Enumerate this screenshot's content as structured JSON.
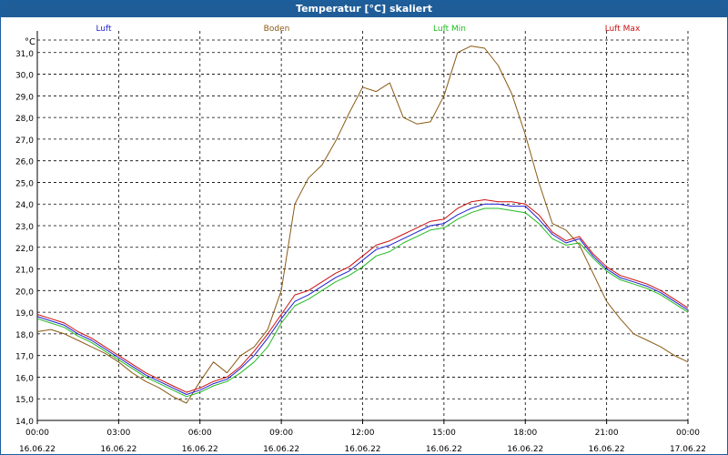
{
  "window": {
    "title": "Temperatur [°C] skaliert"
  },
  "chart_data": {
    "type": "line",
    "title": "Temperatur [°C] skaliert",
    "ylabel": "°C",
    "xlabel": "",
    "ylim": [
      14.0,
      32.0
    ],
    "y_ticks": [
      "14,0",
      "15,0",
      "16,0",
      "17,0",
      "18,0",
      "19,0",
      "20,0",
      "21,0",
      "22,0",
      "23,0",
      "24,0",
      "25,0",
      "26,0",
      "27,0",
      "28,0",
      "29,0",
      "30,0",
      "31,0"
    ],
    "x_ticks": [
      {
        "time": "00:00",
        "date": "16.06.22"
      },
      {
        "time": "03:00",
        "date": "16.06.22"
      },
      {
        "time": "06:00",
        "date": "16.06.22"
      },
      {
        "time": "09:00",
        "date": "16.06.22"
      },
      {
        "time": "12:00",
        "date": "16.06.22"
      },
      {
        "time": "15:00",
        "date": "16.06.22"
      },
      {
        "time": "18:00",
        "date": "16.06.22"
      },
      {
        "time": "21:00",
        "date": "16.06.22"
      },
      {
        "time": "00:00",
        "date": "17.06.22"
      }
    ],
    "x_range_hours": [
      0,
      24
    ],
    "grid": true,
    "legend_position": "top",
    "series": [
      {
        "name": "Luft",
        "color": "#1f1fd0",
        "x": [
          0,
          0.5,
          1,
          1.5,
          2,
          2.5,
          3,
          3.5,
          4,
          4.5,
          5,
          5.5,
          6,
          6.5,
          7,
          7.5,
          8,
          8.5,
          9,
          9.5,
          10,
          10.5,
          11,
          11.5,
          12,
          12.5,
          13,
          13.5,
          14,
          14.5,
          15,
          15.5,
          16,
          16.5,
          17,
          17.5,
          18,
          18.5,
          19,
          19.5,
          20,
          20.5,
          21,
          21.5,
          22,
          22.5,
          23,
          23.5,
          24
        ],
        "y": [
          18.8,
          18.6,
          18.4,
          18.0,
          17.7,
          17.3,
          16.9,
          16.5,
          16.1,
          15.8,
          15.5,
          15.2,
          15.4,
          15.7,
          15.9,
          16.4,
          17.0,
          17.8,
          18.7,
          19.5,
          19.8,
          20.2,
          20.6,
          20.9,
          21.4,
          21.9,
          22.1,
          22.4,
          22.7,
          23.0,
          23.1,
          23.5,
          23.8,
          24.0,
          24.0,
          23.9,
          23.9,
          23.3,
          22.6,
          22.2,
          22.4,
          21.6,
          21.0,
          20.6,
          20.4,
          20.2,
          19.9,
          19.5,
          19.1
        ]
      },
      {
        "name": "Boden",
        "color": "#8a5a14",
        "x": [
          0,
          0.5,
          1,
          1.5,
          2,
          2.5,
          3,
          3.5,
          4,
          4.5,
          5,
          5.5,
          6,
          6.5,
          7,
          7.5,
          8,
          8.5,
          9,
          9.5,
          10,
          10.5,
          11,
          11.5,
          12,
          12.5,
          13,
          13.5,
          14,
          14.5,
          15,
          15.5,
          16,
          16.5,
          17,
          17.5,
          18,
          18.5,
          19,
          19.5,
          20,
          20.5,
          21,
          21.5,
          22,
          22.5,
          23,
          23.5,
          24
        ],
        "y": [
          18.1,
          18.2,
          18.0,
          17.7,
          17.4,
          17.1,
          16.7,
          16.2,
          15.8,
          15.5,
          15.1,
          14.8,
          15.8,
          16.7,
          16.2,
          17.0,
          17.4,
          18.2,
          20.0,
          24.0,
          25.2,
          25.8,
          26.9,
          28.2,
          29.4,
          29.2,
          29.6,
          28.0,
          27.7,
          27.8,
          29.0,
          31.0,
          31.3,
          31.2,
          30.4,
          29.1,
          27.2,
          25.0,
          23.1,
          22.8,
          22.1,
          20.8,
          19.5,
          18.7,
          18.0,
          17.7,
          17.4,
          17.0,
          16.7
        ]
      },
      {
        "name": "Luft Min",
        "color": "#22bb22",
        "x": [
          0,
          0.5,
          1,
          1.5,
          2,
          2.5,
          3,
          3.5,
          4,
          4.5,
          5,
          5.5,
          6,
          6.5,
          7,
          7.5,
          8,
          8.5,
          9,
          9.5,
          10,
          10.5,
          11,
          11.5,
          12,
          12.5,
          13,
          13.5,
          14,
          14.5,
          15,
          15.5,
          16,
          16.5,
          17,
          17.5,
          18,
          18.5,
          19,
          19.5,
          20,
          20.5,
          21,
          21.5,
          22,
          22.5,
          23,
          23.5,
          24
        ],
        "y": [
          18.7,
          18.5,
          18.3,
          17.9,
          17.6,
          17.2,
          16.8,
          16.4,
          16.0,
          15.7,
          15.4,
          15.1,
          15.3,
          15.6,
          15.8,
          16.2,
          16.7,
          17.4,
          18.5,
          19.3,
          19.6,
          20.0,
          20.4,
          20.7,
          21.1,
          21.6,
          21.8,
          22.2,
          22.5,
          22.8,
          22.9,
          23.3,
          23.6,
          23.8,
          23.8,
          23.7,
          23.6,
          23.1,
          22.4,
          22.1,
          22.2,
          21.5,
          20.9,
          20.5,
          20.3,
          20.1,
          19.8,
          19.4,
          19.0
        ]
      },
      {
        "name": "Luft Max",
        "color": "#cc1010",
        "x": [
          0,
          0.5,
          1,
          1.5,
          2,
          2.5,
          3,
          3.5,
          4,
          4.5,
          5,
          5.5,
          6,
          6.5,
          7,
          7.5,
          8,
          8.5,
          9,
          9.5,
          10,
          10.5,
          11,
          11.5,
          12,
          12.5,
          13,
          13.5,
          14,
          14.5,
          15,
          15.5,
          16,
          16.5,
          17,
          17.5,
          18,
          18.5,
          19,
          19.5,
          20,
          20.5,
          21,
          21.5,
          22,
          22.5,
          23,
          23.5,
          24
        ],
        "y": [
          18.9,
          18.7,
          18.5,
          18.1,
          17.8,
          17.4,
          17.0,
          16.6,
          16.2,
          15.9,
          15.6,
          15.3,
          15.5,
          15.8,
          16.0,
          16.5,
          17.2,
          18.0,
          18.9,
          19.8,
          20.0,
          20.4,
          20.8,
          21.1,
          21.6,
          22.1,
          22.3,
          22.6,
          22.9,
          23.2,
          23.3,
          23.8,
          24.1,
          24.2,
          24.1,
          24.1,
          24.0,
          23.5,
          22.7,
          22.3,
          22.5,
          21.7,
          21.1,
          20.7,
          20.5,
          20.3,
          20.0,
          19.6,
          19.2
        ]
      }
    ]
  }
}
